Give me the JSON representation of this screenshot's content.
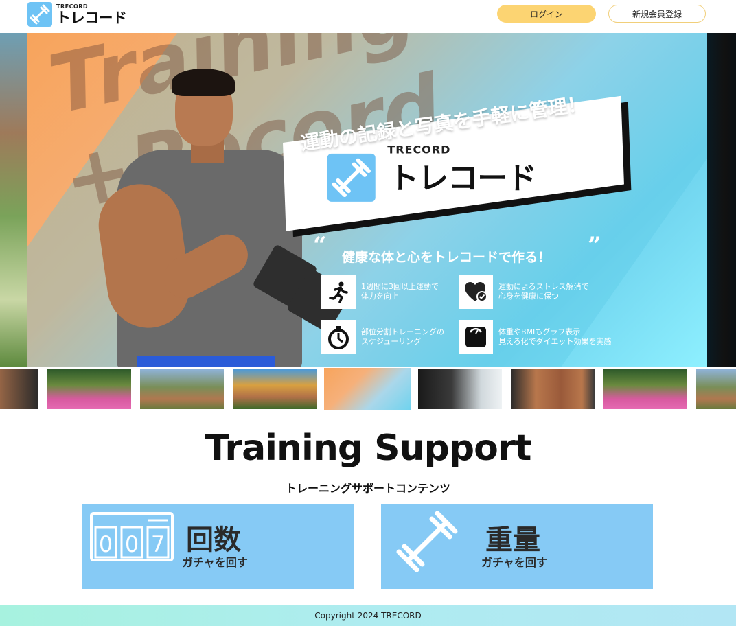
{
  "header": {
    "logo_sub": "TRECORD",
    "logo_main": "トレコード",
    "login_label": "ログイン",
    "register_label": "新規会員登録"
  },
  "hero": {
    "big_word_1": "Training",
    "big_word_2": "+Record",
    "catch": "運動の記録と写真を手軽に管理！",
    "brand_sub": "TRECORD",
    "brand_main": "トレコード",
    "quote_open": "“",
    "quote_close": "”",
    "tagline": "健康な体と心をトレコードで作る！",
    "features": [
      {
        "icon": "running-icon",
        "line1": "1週間に3回以上運動で",
        "line2": "体力を向上"
      },
      {
        "icon": "heart-check-icon",
        "line1": "運動によるストレス解消で",
        "line2": "心身を健康に保つ"
      },
      {
        "icon": "stopwatch-icon",
        "line1": "部位分割トレーニングの",
        "line2": "スケジューリング"
      },
      {
        "icon": "scale-icon",
        "line1": "体重やBMIもグラフ表示",
        "line2": "見える化でダイエット効果を実感"
      }
    ]
  },
  "thumbnails": {
    "count": 9,
    "active_index": 4
  },
  "support": {
    "title": "Training Support",
    "subtitle": "トレーニングサポートコンテンツ",
    "cards": [
      {
        "title": "回数",
        "sub": "ガチャを回す",
        "icon": "counter-icon",
        "counter_digits": "007"
      },
      {
        "title": "重量",
        "sub": "ガチャを回す",
        "icon": "barbell-icon"
      }
    ]
  },
  "footer": {
    "copyright": "Copyright 2024 TRECORD"
  },
  "colors": {
    "accent_yellow": "#fcd472",
    "card_blue": "#86caf5",
    "logo_blue": "#6ec3f5",
    "footer_start": "#a7f2df",
    "footer_end": "#b2e6f4"
  }
}
